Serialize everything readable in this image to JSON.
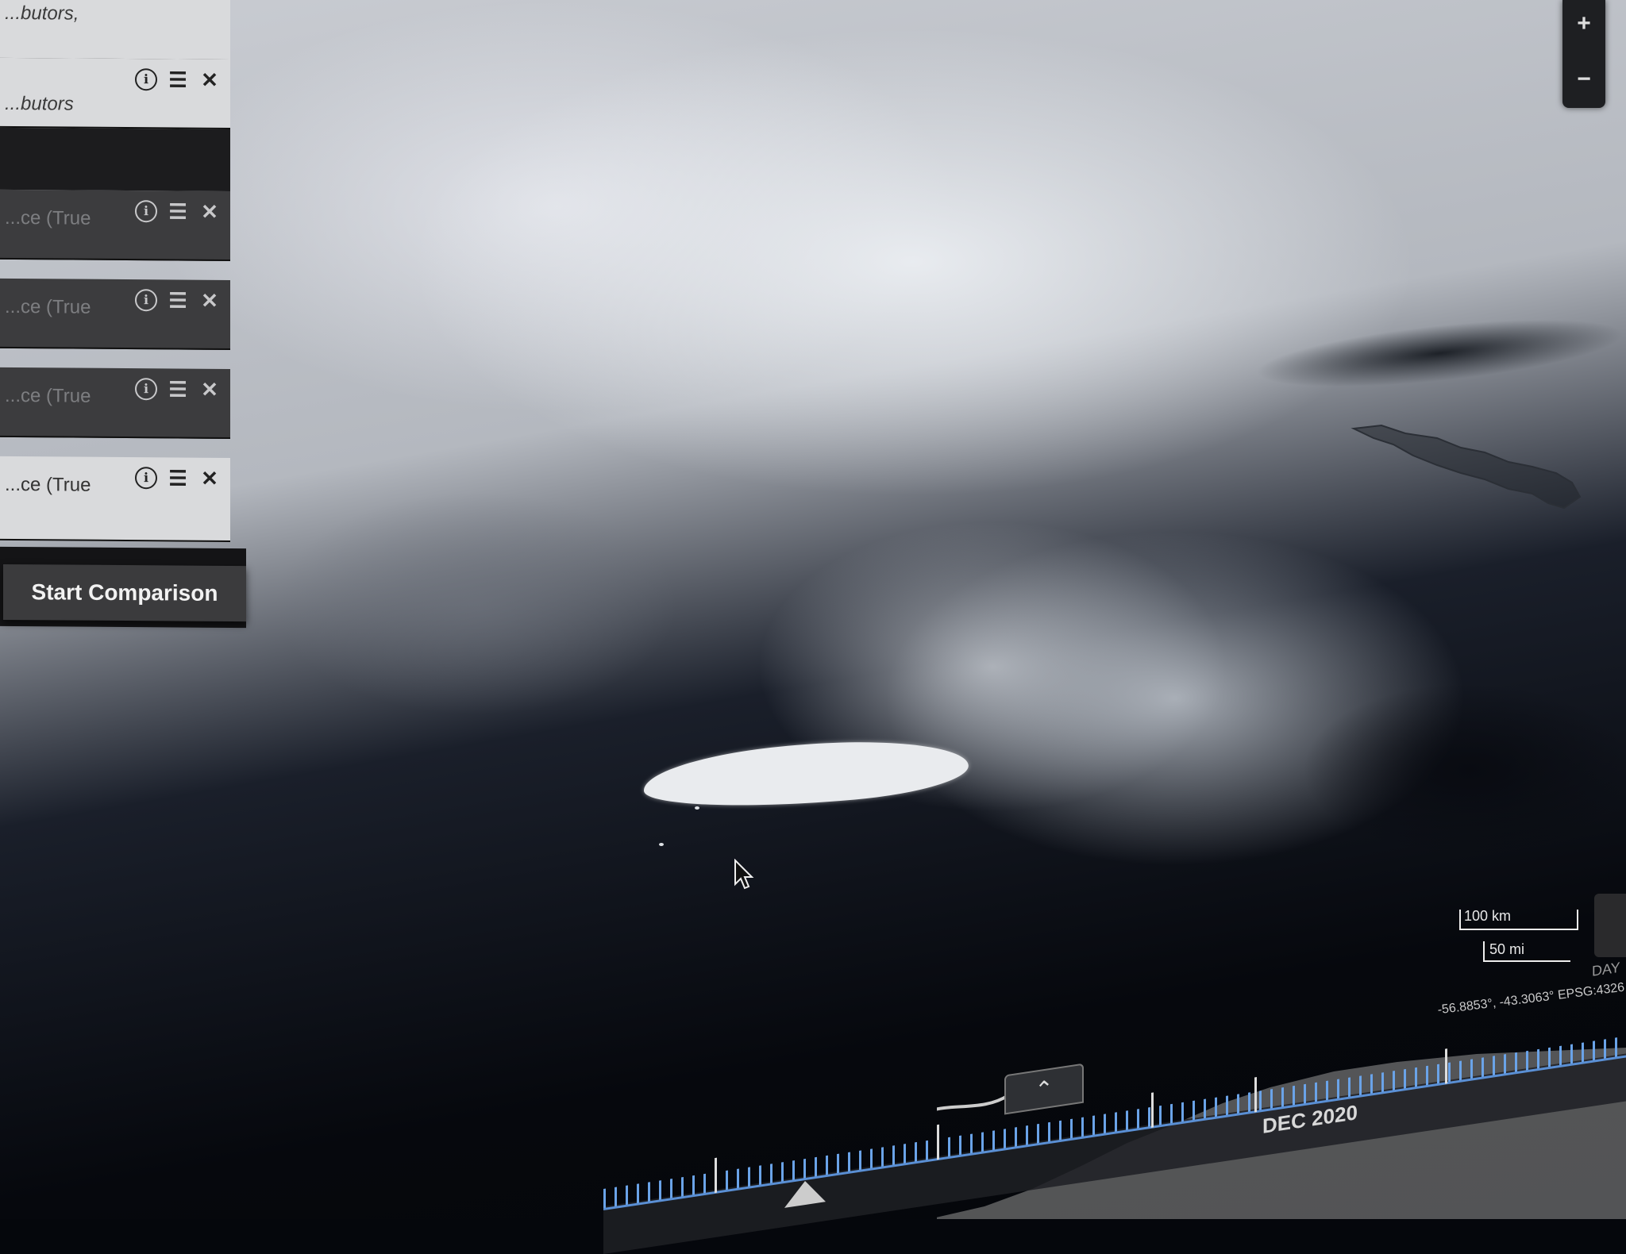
{
  "layers": [
    {
      "name": "...butors,",
      "style": "light"
    },
    {
      "name": "...butors",
      "style": "light"
    },
    {
      "name": "...ce (True",
      "style": "dark"
    },
    {
      "name": "...ce (True",
      "style": "dark"
    },
    {
      "name": "...ce (True",
      "style": "dark"
    },
    {
      "name": "...ce (True",
      "style": "light"
    }
  ],
  "layer_icons": {
    "info": "i",
    "options": "☰",
    "remove": "✕"
  },
  "compare_button": "Start Comparison",
  "zoom": {
    "in": "+",
    "out": "−"
  },
  "scale": {
    "km": "100 km",
    "mi": "50 mi"
  },
  "coordinates": "-56.8853°, -43.3063°  EPSG:4326",
  "timeline": {
    "month_label": "DEC 2020",
    "zoom_label": "DAY",
    "toggle_icon": "⌃"
  },
  "icons": [
    "info-icon",
    "options-icon",
    "close-icon",
    "chevron-up-icon",
    "cursor-icon"
  ]
}
